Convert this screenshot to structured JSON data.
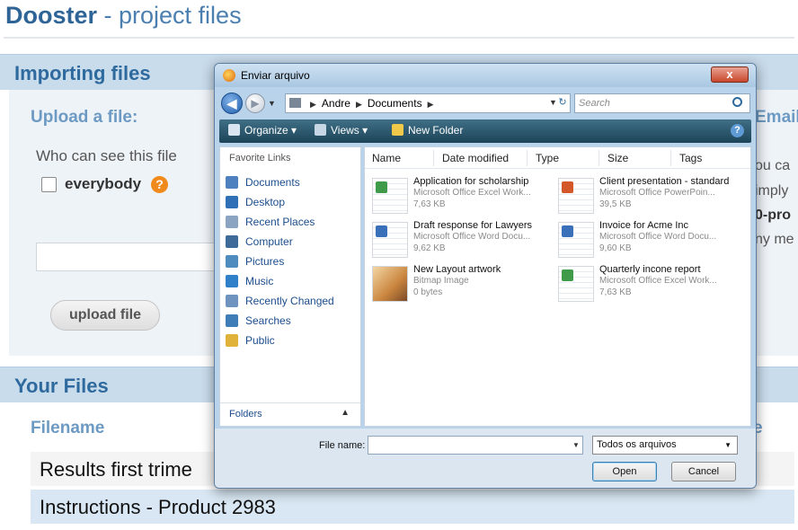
{
  "page": {
    "brand": {
      "name": "Dooster",
      "rest": " - project files"
    },
    "importing": {
      "title": "Importing files",
      "upload_title": "Upload a file:",
      "who_label": "Who can see this file",
      "everybody_label": "everybody",
      "help_glyph": "?",
      "upload_button": "upload file"
    },
    "right_partial": {
      "heading": "Email",
      "line1": "ou ca",
      "line2": "imply",
      "line3": "0-pro",
      "line4": "ny me"
    },
    "your_files": {
      "title": "Your Files",
      "col_filename": "Filename",
      "col_right": "e",
      "rows": [
        "Results first trime",
        "Instructions - Product 2983"
      ]
    }
  },
  "dialog": {
    "title": "Enviar arquivo",
    "close_glyph": "x",
    "nav": {
      "back_glyph": "◀",
      "forward_glyph": "▶",
      "history_glyph": "▼"
    },
    "address": {
      "segments": [
        "Andre",
        "Documents"
      ],
      "separator": "▶",
      "dropdown_glyph": "▼",
      "refresh_glyph": "↻"
    },
    "search_placeholder": "Search",
    "toolbar": {
      "organize": "Organize ▾",
      "views": "Views ▾",
      "new_folder": "New Folder",
      "help_glyph": "?"
    },
    "favorites_heading": "Favorite Links",
    "favorites": [
      {
        "label": "Documents",
        "icon": "documents-icon",
        "color": "#4e7fbf"
      },
      {
        "label": "Desktop",
        "icon": "desktop-icon",
        "color": "#2f6fb5"
      },
      {
        "label": "Recent Places",
        "icon": "recent-places-icon",
        "color": "#8aa4c1"
      },
      {
        "label": "Computer",
        "icon": "computer-icon",
        "color": "#3d6a99"
      },
      {
        "label": "Pictures",
        "icon": "pictures-icon",
        "color": "#4e8bbf"
      },
      {
        "label": "Music",
        "icon": "music-icon",
        "color": "#2f7fc9"
      },
      {
        "label": "Recently Changed",
        "icon": "recently-changed-icon",
        "color": "#6f93bf"
      },
      {
        "label": "Searches",
        "icon": "searches-icon",
        "color": "#3f7db8"
      },
      {
        "label": "Public",
        "icon": "public-icon",
        "color": "#e0b23a"
      }
    ],
    "folders_label": "Folders",
    "folders_chevron": "▲",
    "columns": [
      "Name",
      "Date modified",
      "Type",
      "Size",
      "Tags"
    ],
    "files": [
      {
        "name": "Application for scholarship",
        "type": "Microsoft Office Excel Work...",
        "size": "7,63 KB",
        "kind": "excel-file-icon"
      },
      {
        "name": "Client presentation - standard",
        "type": "Microsoft Office PowerPoin...",
        "size": "39,5 KB",
        "kind": "powerpoint-file-icon"
      },
      {
        "name": "Draft response for Lawyers",
        "type": "Microsoft Office Word Docu...",
        "size": "9,62 KB",
        "kind": "word-file-icon"
      },
      {
        "name": "Invoice for Acme Inc",
        "type": "Microsoft Office Word Docu...",
        "size": "9,60 KB",
        "kind": "word-file-icon"
      },
      {
        "name": "New Layout artwork",
        "type": "Bitmap Image",
        "size": "0 bytes",
        "kind": "bitmap-file-icon"
      },
      {
        "name": "Quarterly incone report",
        "type": "Microsoft Office Excel Work...",
        "size": "7,63 KB",
        "kind": "excel-file-icon"
      }
    ],
    "file_name_label": "File name:",
    "file_name_value": "",
    "filter_value": "Todos os arquivos",
    "open_button": "Open",
    "cancel_button": "Cancel",
    "colors": {
      "excel": "#3f9a4a",
      "word": "#3a6fb9",
      "powerpoint": "#d4572a",
      "bitmap": "#c9853e"
    }
  }
}
